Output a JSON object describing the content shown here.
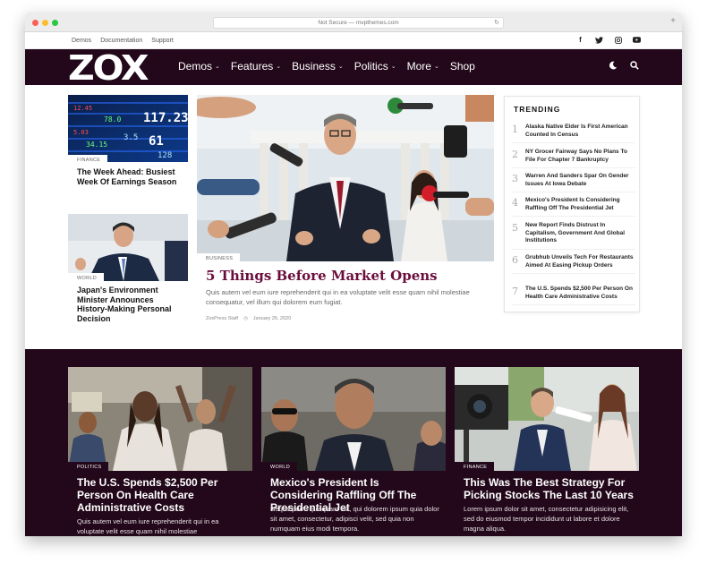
{
  "browser": {
    "url": "Not Secure — mvpthemes.com"
  },
  "topbar": {
    "links": [
      "Demos",
      "Documentation",
      "Support"
    ],
    "social_icons": [
      "facebook-icon",
      "twitter-icon",
      "instagram-icon",
      "youtube-icon"
    ]
  },
  "nav": {
    "logo": "ZOX",
    "menu": [
      {
        "label": "Demos",
        "dropdown": true
      },
      {
        "label": "Features",
        "dropdown": true
      },
      {
        "label": "Business",
        "dropdown": true
      },
      {
        "label": "Politics",
        "dropdown": true
      },
      {
        "label": "More",
        "dropdown": true
      },
      {
        "label": "Shop",
        "dropdown": false
      }
    ],
    "icons": [
      "moon-icon",
      "search-icon"
    ]
  },
  "left_stories": [
    {
      "category": "FINANCE",
      "title": "The Week Ahead: Busiest Week Of Earnings Season"
    },
    {
      "category": "WORLD",
      "title": "Japan's Environment Minister Announces History-Making Personal Decision"
    }
  ],
  "featured": {
    "category": "BUSINESS",
    "title": "5 Things Before Market Opens",
    "excerpt": "Quis autem vel eum iure reprehenderit qui in ea voluptate velit esse quam nihil molestiae consequatur, vel illum qui dolorem eum fugiat.",
    "author": "ZoxPress Staff",
    "date": "January 25, 2020"
  },
  "trending": {
    "heading": "TRENDING",
    "items": [
      {
        "num": "1",
        "title": "Alaska Native Elder Is First American Counted In Census"
      },
      {
        "num": "2",
        "title": "NY Grocer Fairway Says No Plans To File For Chapter 7 Bankruptcy"
      },
      {
        "num": "3",
        "title": "Warren And Sanders Spar On Gender Issues At Iowa Debate"
      },
      {
        "num": "4",
        "title": "Mexico's President Is Considering Raffling Off The Presidential Jet"
      },
      {
        "num": "5",
        "title": "New Report Finds Distrust In Capitalism, Government And Global Institutions"
      },
      {
        "num": "6",
        "title": "Grubhub Unveils Tech For Restaurants Aimed At Easing Pickup Orders"
      },
      {
        "num": "7",
        "title": "The U.S. Spends $2,500 Per Person On Health Care Administrative Costs"
      }
    ]
  },
  "bottom_cards": [
    {
      "category": "POLITICS",
      "title": "The U.S. Spends $2,500 Per Person On Health Care Administrative Costs",
      "excerpt": "Quis autem vel eum iure reprehenderit qui in ea voluptate velit esse quam nihil molestiae"
    },
    {
      "category": "WORLD",
      "title": "Mexico's President Is Considering Raffling Off The Presidential Jet",
      "excerpt": "Neque porro quisquam est, qui dolorem ipsum quia dolor sit amet, consectetur, adipisci velit, sed quia non numquam eius modi tempora."
    },
    {
      "category": "FINANCE",
      "title": "This Was The Best Strategy For Picking Stocks The Last 10 Years",
      "excerpt": "Lorem ipsum dolor sit amet, consectetur adipisicing elit, sed do eiusmod tempor incididunt ut labore et dolore magna aliqua."
    }
  ],
  "colors": {
    "nav_bg": "#22081a",
    "accent": "#6b0e3c"
  }
}
